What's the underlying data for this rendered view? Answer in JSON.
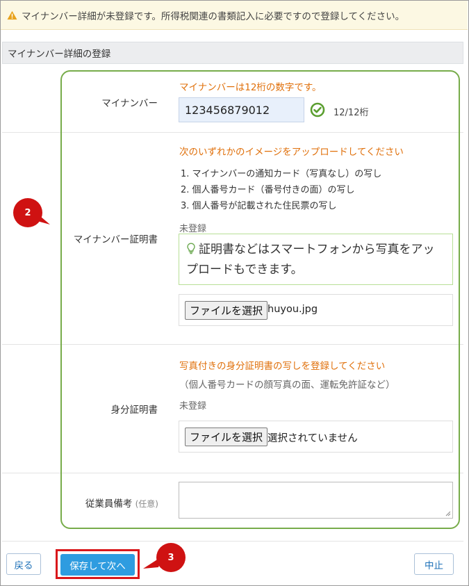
{
  "alert": {
    "message": "マイナンバー詳細が未登録です。所得税関連の書類記入に必要ですので登録してください。"
  },
  "section": {
    "title": "マイナンバー詳細の登録"
  },
  "mynumber": {
    "label": "マイナンバー",
    "hint": "マイナンバーは12桁の数字です。",
    "value": "123456879012",
    "digit_count": "12/12桁"
  },
  "certificate": {
    "label": "マイナンバー証明書",
    "instruction": "次のいずれかのイメージをアップロードしてください",
    "options": [
      "1. マイナンバーの通知カード（写真なし）の写し",
      "2. 個人番号カード（番号付きの面）の写し",
      "3. 個人番号が記載された住民票の写し"
    ],
    "status": "未登録",
    "tip": "証明書などはスマートフォンから写真をアップロードもできます。",
    "file_button": "ファイルを選択",
    "file_name": "huyou.jpg"
  },
  "id_card": {
    "label": "身分証明書",
    "instruction": "写真付きの身分証明書の写しを登録してください",
    "sub_instruction": "（個人番号カードの顔写真の面、運転免許証など）",
    "status": "未登録",
    "file_button": "ファイルを選択",
    "file_name": "選択されていません"
  },
  "remarks": {
    "label": "従業員備考",
    "optional": "(任意)",
    "value": ""
  },
  "buttons": {
    "back": "戻る",
    "save_next": "保存して次へ",
    "cancel": "中止"
  },
  "callouts": {
    "step2": "2",
    "step3": "3"
  },
  "colors": {
    "accent_orange": "#e0700b",
    "highlight_green": "#77ac4a",
    "primary_blue": "#2e9ce0",
    "callout_red": "#d9171b"
  }
}
